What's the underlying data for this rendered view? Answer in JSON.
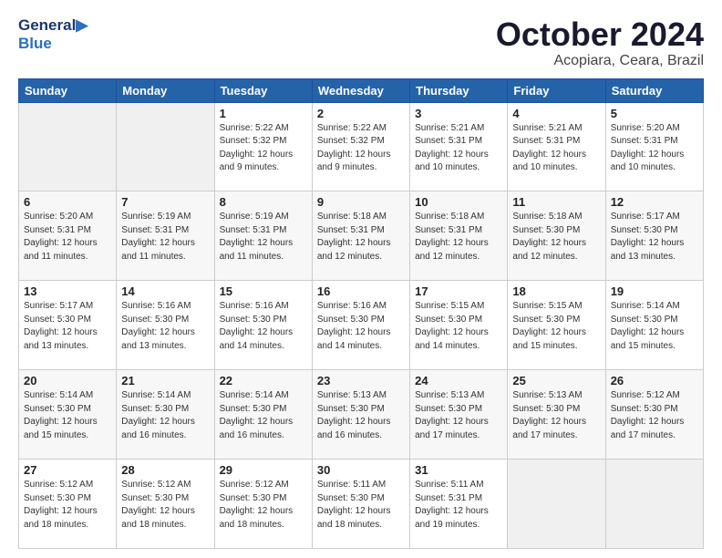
{
  "header": {
    "logo_line1": "General",
    "logo_line2": "Blue",
    "title": "October 2024",
    "subtitle": "Acopiara, Ceara, Brazil"
  },
  "calendar": {
    "headers": [
      "Sunday",
      "Monday",
      "Tuesday",
      "Wednesday",
      "Thursday",
      "Friday",
      "Saturday"
    ],
    "weeks": [
      [
        {
          "day": "",
          "info": ""
        },
        {
          "day": "",
          "info": ""
        },
        {
          "day": "1",
          "info": "Sunrise: 5:22 AM\nSunset: 5:32 PM\nDaylight: 12 hours\nand 9 minutes."
        },
        {
          "day": "2",
          "info": "Sunrise: 5:22 AM\nSunset: 5:32 PM\nDaylight: 12 hours\nand 9 minutes."
        },
        {
          "day": "3",
          "info": "Sunrise: 5:21 AM\nSunset: 5:31 PM\nDaylight: 12 hours\nand 10 minutes."
        },
        {
          "day": "4",
          "info": "Sunrise: 5:21 AM\nSunset: 5:31 PM\nDaylight: 12 hours\nand 10 minutes."
        },
        {
          "day": "5",
          "info": "Sunrise: 5:20 AM\nSunset: 5:31 PM\nDaylight: 12 hours\nand 10 minutes."
        }
      ],
      [
        {
          "day": "6",
          "info": "Sunrise: 5:20 AM\nSunset: 5:31 PM\nDaylight: 12 hours\nand 11 minutes."
        },
        {
          "day": "7",
          "info": "Sunrise: 5:19 AM\nSunset: 5:31 PM\nDaylight: 12 hours\nand 11 minutes."
        },
        {
          "day": "8",
          "info": "Sunrise: 5:19 AM\nSunset: 5:31 PM\nDaylight: 12 hours\nand 11 minutes."
        },
        {
          "day": "9",
          "info": "Sunrise: 5:18 AM\nSunset: 5:31 PM\nDaylight: 12 hours\nand 12 minutes."
        },
        {
          "day": "10",
          "info": "Sunrise: 5:18 AM\nSunset: 5:31 PM\nDaylight: 12 hours\nand 12 minutes."
        },
        {
          "day": "11",
          "info": "Sunrise: 5:18 AM\nSunset: 5:30 PM\nDaylight: 12 hours\nand 12 minutes."
        },
        {
          "day": "12",
          "info": "Sunrise: 5:17 AM\nSunset: 5:30 PM\nDaylight: 12 hours\nand 13 minutes."
        }
      ],
      [
        {
          "day": "13",
          "info": "Sunrise: 5:17 AM\nSunset: 5:30 PM\nDaylight: 12 hours\nand 13 minutes."
        },
        {
          "day": "14",
          "info": "Sunrise: 5:16 AM\nSunset: 5:30 PM\nDaylight: 12 hours\nand 13 minutes."
        },
        {
          "day": "15",
          "info": "Sunrise: 5:16 AM\nSunset: 5:30 PM\nDaylight: 12 hours\nand 14 minutes."
        },
        {
          "day": "16",
          "info": "Sunrise: 5:16 AM\nSunset: 5:30 PM\nDaylight: 12 hours\nand 14 minutes."
        },
        {
          "day": "17",
          "info": "Sunrise: 5:15 AM\nSunset: 5:30 PM\nDaylight: 12 hours\nand 14 minutes."
        },
        {
          "day": "18",
          "info": "Sunrise: 5:15 AM\nSunset: 5:30 PM\nDaylight: 12 hours\nand 15 minutes."
        },
        {
          "day": "19",
          "info": "Sunrise: 5:14 AM\nSunset: 5:30 PM\nDaylight: 12 hours\nand 15 minutes."
        }
      ],
      [
        {
          "day": "20",
          "info": "Sunrise: 5:14 AM\nSunset: 5:30 PM\nDaylight: 12 hours\nand 15 minutes."
        },
        {
          "day": "21",
          "info": "Sunrise: 5:14 AM\nSunset: 5:30 PM\nDaylight: 12 hours\nand 16 minutes."
        },
        {
          "day": "22",
          "info": "Sunrise: 5:14 AM\nSunset: 5:30 PM\nDaylight: 12 hours\nand 16 minutes."
        },
        {
          "day": "23",
          "info": "Sunrise: 5:13 AM\nSunset: 5:30 PM\nDaylight: 12 hours\nand 16 minutes."
        },
        {
          "day": "24",
          "info": "Sunrise: 5:13 AM\nSunset: 5:30 PM\nDaylight: 12 hours\nand 17 minutes."
        },
        {
          "day": "25",
          "info": "Sunrise: 5:13 AM\nSunset: 5:30 PM\nDaylight: 12 hours\nand 17 minutes."
        },
        {
          "day": "26",
          "info": "Sunrise: 5:12 AM\nSunset: 5:30 PM\nDaylight: 12 hours\nand 17 minutes."
        }
      ],
      [
        {
          "day": "27",
          "info": "Sunrise: 5:12 AM\nSunset: 5:30 PM\nDaylight: 12 hours\nand 18 minutes."
        },
        {
          "day": "28",
          "info": "Sunrise: 5:12 AM\nSunset: 5:30 PM\nDaylight: 12 hours\nand 18 minutes."
        },
        {
          "day": "29",
          "info": "Sunrise: 5:12 AM\nSunset: 5:30 PM\nDaylight: 12 hours\nand 18 minutes."
        },
        {
          "day": "30",
          "info": "Sunrise: 5:11 AM\nSunset: 5:30 PM\nDaylight: 12 hours\nand 18 minutes."
        },
        {
          "day": "31",
          "info": "Sunrise: 5:11 AM\nSunset: 5:31 PM\nDaylight: 12 hours\nand 19 minutes."
        },
        {
          "day": "",
          "info": ""
        },
        {
          "day": "",
          "info": ""
        }
      ]
    ]
  }
}
